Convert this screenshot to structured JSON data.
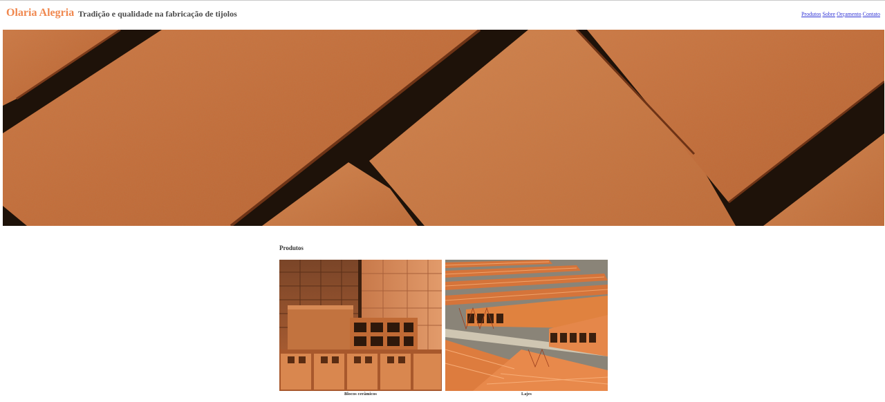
{
  "header": {
    "brand": "Olaria Alegria",
    "tagline": "Tradição e qualidade na fabricação de tijolos"
  },
  "nav": {
    "items": [
      {
        "label": "Produtos"
      },
      {
        "label": "Sobre"
      },
      {
        "label": "Orçamento"
      },
      {
        "label": "Contato"
      }
    ]
  },
  "colors": {
    "brand": "#f0884f",
    "link": "#2f33d6",
    "brick": "#c9703d"
  },
  "products": {
    "title": "Produtos",
    "items": [
      {
        "caption": "Blocos cerâmicos"
      },
      {
        "caption": "Lajes"
      }
    ]
  }
}
